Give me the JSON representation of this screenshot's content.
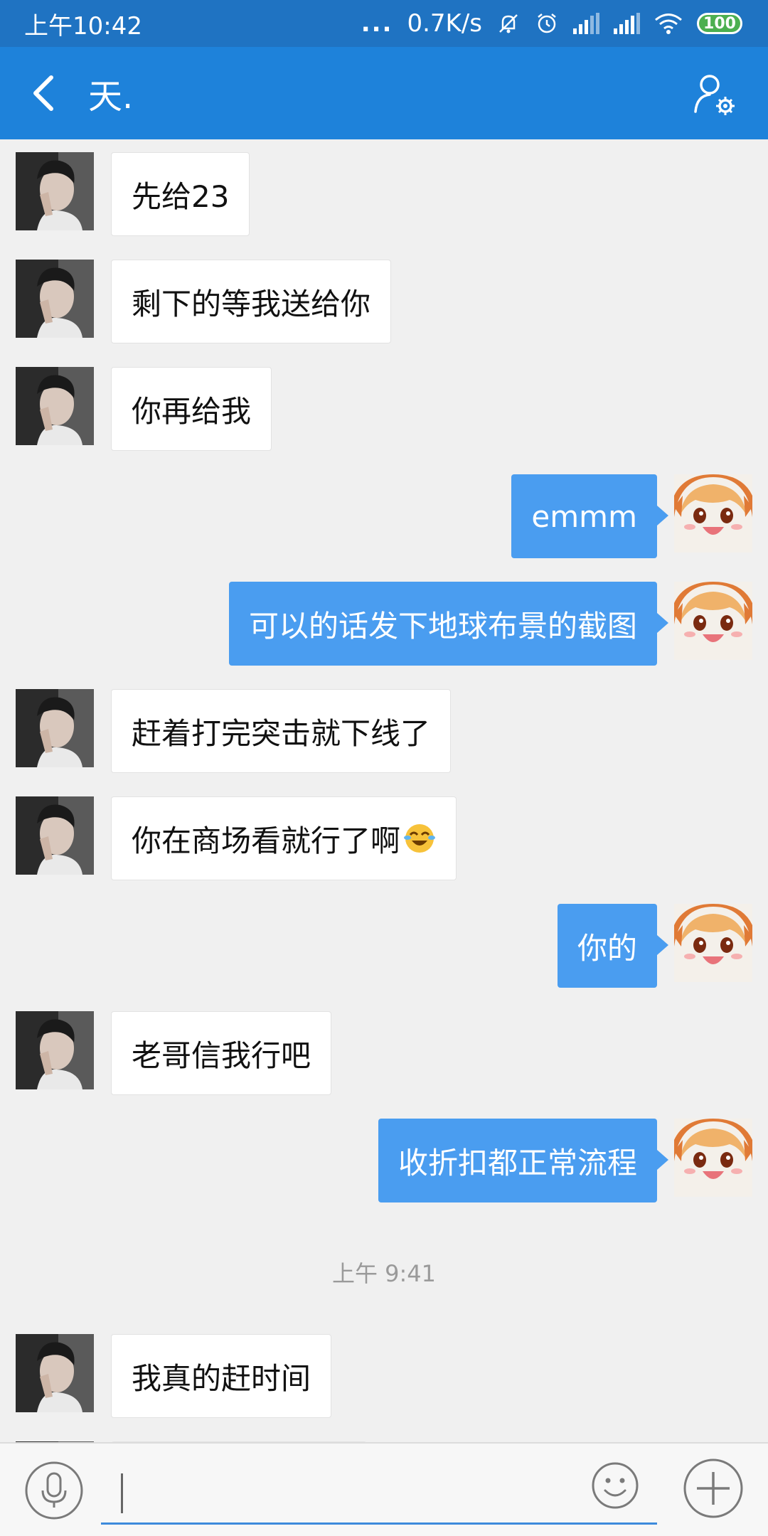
{
  "status_bar": {
    "time": "上午10:42",
    "dots": "...",
    "net_speed": "0.7K/s",
    "battery": "100"
  },
  "header": {
    "title": "天.",
    "back_icon": "chevron-left-icon",
    "profile_icon": "profile-settings-icon"
  },
  "messages": [
    {
      "side": "in",
      "text": "先给23"
    },
    {
      "side": "in",
      "text": "剩下的等我送给你"
    },
    {
      "side": "in",
      "text": "你再给我"
    },
    {
      "side": "out",
      "text": "emmm"
    },
    {
      "side": "out",
      "text": "可以的话发下地球布景的截图"
    },
    {
      "side": "in",
      "text": "赶着打完突击就下线了"
    },
    {
      "side": "in",
      "text": "你在商场看就行了啊",
      "emoji": "laughing-tears-emoji"
    },
    {
      "side": "out",
      "text": "你的"
    },
    {
      "side": "in",
      "text": "老哥信我行吧"
    },
    {
      "side": "out",
      "text": "收折扣都正常流程"
    },
    {
      "side": "in",
      "text": "我真的赶时间"
    },
    {
      "side": "in",
      "text": ""
    }
  ],
  "time_separator": "上午 9:41",
  "input_bar": {
    "voice_icon": "microphone-icon",
    "input_value": "",
    "emoji_icon": "smiley-icon",
    "plus_icon": "plus-icon"
  },
  "colors": {
    "status_bar": "#1f73c2",
    "header": "#1e82da",
    "outgoing_bubble": "#4a9df0",
    "incoming_bubble": "#ffffff",
    "background": "#f0f0f0"
  }
}
